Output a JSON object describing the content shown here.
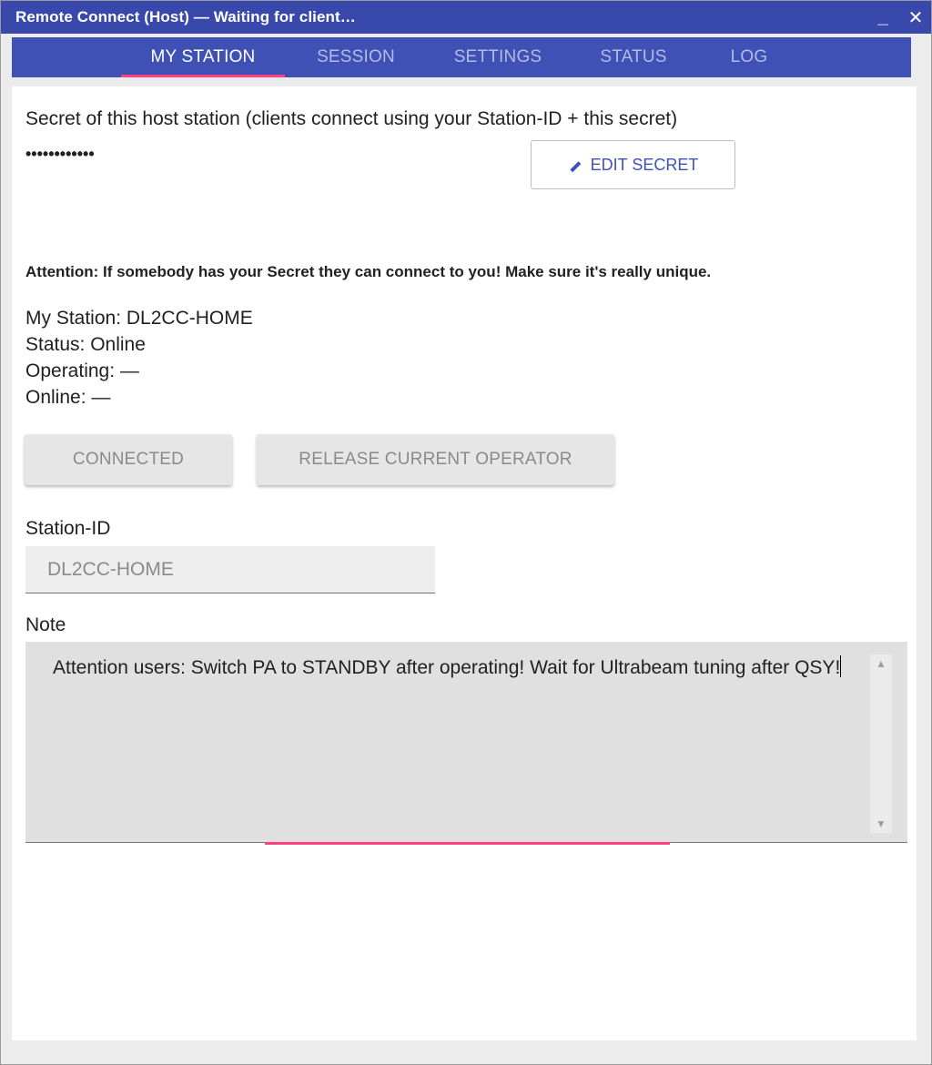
{
  "window": {
    "title": "Remote Connect (Host) — Waiting for client…",
    "minimize_glyph": "_",
    "close_glyph": "✕"
  },
  "tabs": [
    {
      "label": "MY STATION",
      "active": true
    },
    {
      "label": "SESSION",
      "active": false
    },
    {
      "label": "SETTINGS",
      "active": false
    },
    {
      "label": "STATUS",
      "active": false
    },
    {
      "label": "LOG",
      "active": false
    }
  ],
  "secret": {
    "label": "Secret of this host station (clients connect using your Station-ID + this secret)",
    "masked_value": "••••••••••••",
    "edit_button_label": "EDIT SECRET",
    "edit_icon": "pencil-icon"
  },
  "attention_text": "Attention: If somebody has your Secret they can connect to you! Make sure it's really unique.",
  "station_info": {
    "my_station": "My Station: DL2CC-HOME",
    "status": "Status: Online",
    "operating": "Operating: —",
    "online": "Online: —"
  },
  "buttons": {
    "connected": "CONNECTED",
    "release": "RELEASE CURRENT OPERATOR"
  },
  "station_id": {
    "label": "Station-ID",
    "value": "DL2CC-HOME"
  },
  "note": {
    "label": "Note",
    "value": "Attention users: Switch PA to STANDBY after operating! Wait for Ultrabeam tuning after QSY!"
  },
  "colors": {
    "primary": "#3f51b5",
    "title_bar": "#3949ab",
    "accent": "#ff4081"
  }
}
